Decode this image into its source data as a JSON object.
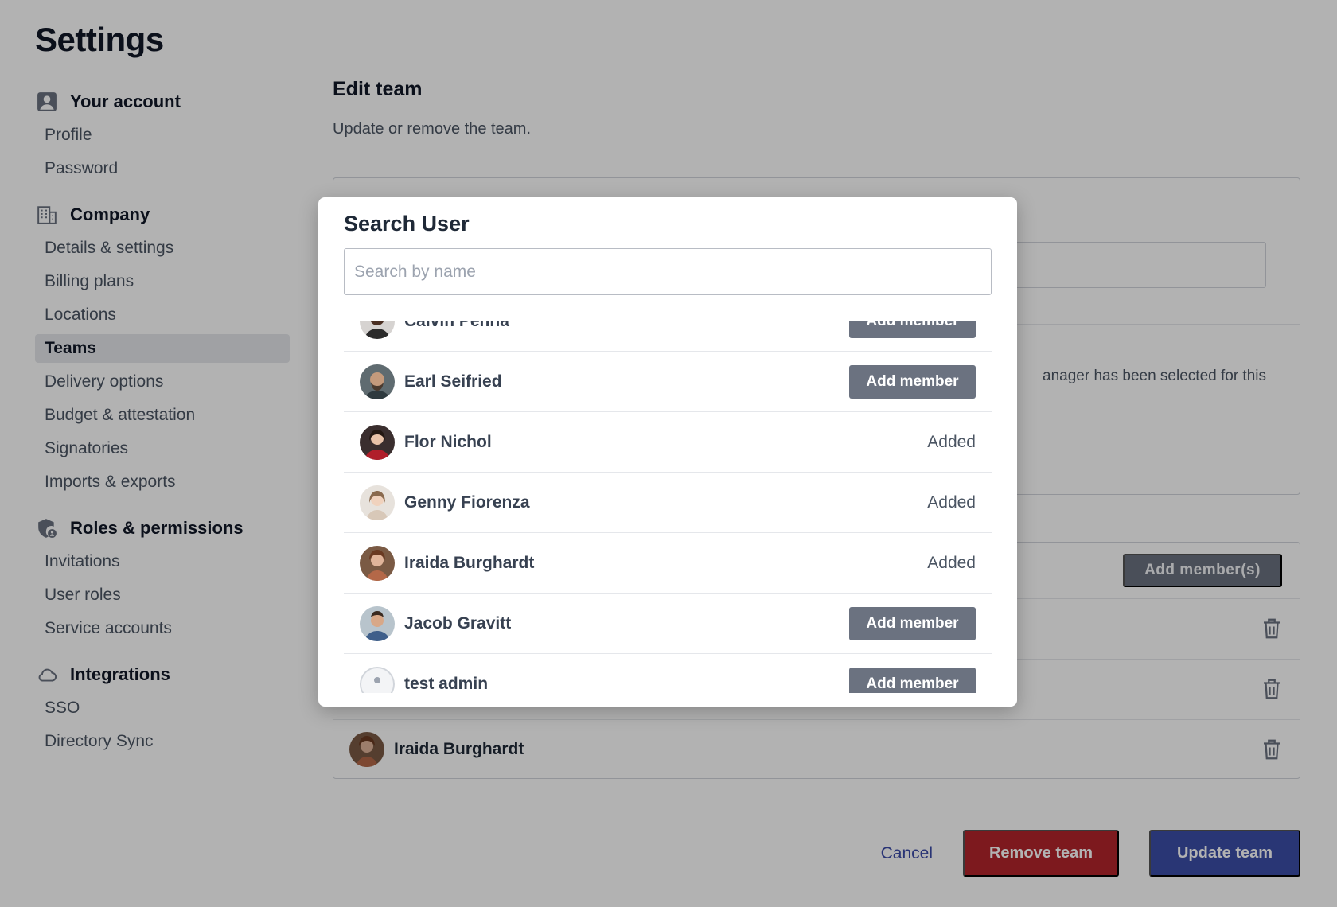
{
  "page": {
    "title": "Settings"
  },
  "sidebar": {
    "sections": [
      {
        "title": "Your account",
        "icon": "user-icon",
        "items": [
          "Profile",
          "Password"
        ]
      },
      {
        "title": "Company",
        "icon": "building-icon",
        "items": [
          "Details & settings",
          "Billing plans",
          "Locations",
          "Teams",
          "Delivery options",
          "Budget & attestation",
          "Signatories",
          "Imports & exports"
        ]
      },
      {
        "title": "Roles & permissions",
        "icon": "shield-icon",
        "items": [
          "Invitations",
          "User roles",
          "Service accounts"
        ]
      },
      {
        "title": "Integrations",
        "icon": "cloud-icon",
        "items": [
          "SSO",
          "Directory Sync"
        ]
      }
    ],
    "active_item": "Teams"
  },
  "main": {
    "title": "Edit team",
    "subtitle": "Update or remove the team.",
    "manager_note_fragment": "anager has been selected for this",
    "add_members_label": "Add member(s)",
    "visible_members": [
      {
        "name": "Iraida Burghardt"
      }
    ],
    "actions": {
      "cancel": "Cancel",
      "remove": "Remove team",
      "update": "Update team"
    }
  },
  "modal": {
    "title": "Search User",
    "search_placeholder": "Search by name",
    "search_value": "",
    "add_label": "Add member",
    "added_label": "Added",
    "users": [
      {
        "name": "Calvin Penna",
        "status": "add"
      },
      {
        "name": "Earl Seifried",
        "status": "add"
      },
      {
        "name": "Flor Nichol",
        "status": "added"
      },
      {
        "name": "Genny Fiorenza",
        "status": "added"
      },
      {
        "name": "Iraida Burghardt",
        "status": "added"
      },
      {
        "name": "Jacob Gravitt",
        "status": "add"
      },
      {
        "name": "test admin",
        "status": "add"
      }
    ]
  },
  "colors": {
    "primary": "#3b4ea8",
    "danger": "#b4252b",
    "muted_button": "#6b7280",
    "active_nav": "#e5e7eb"
  }
}
